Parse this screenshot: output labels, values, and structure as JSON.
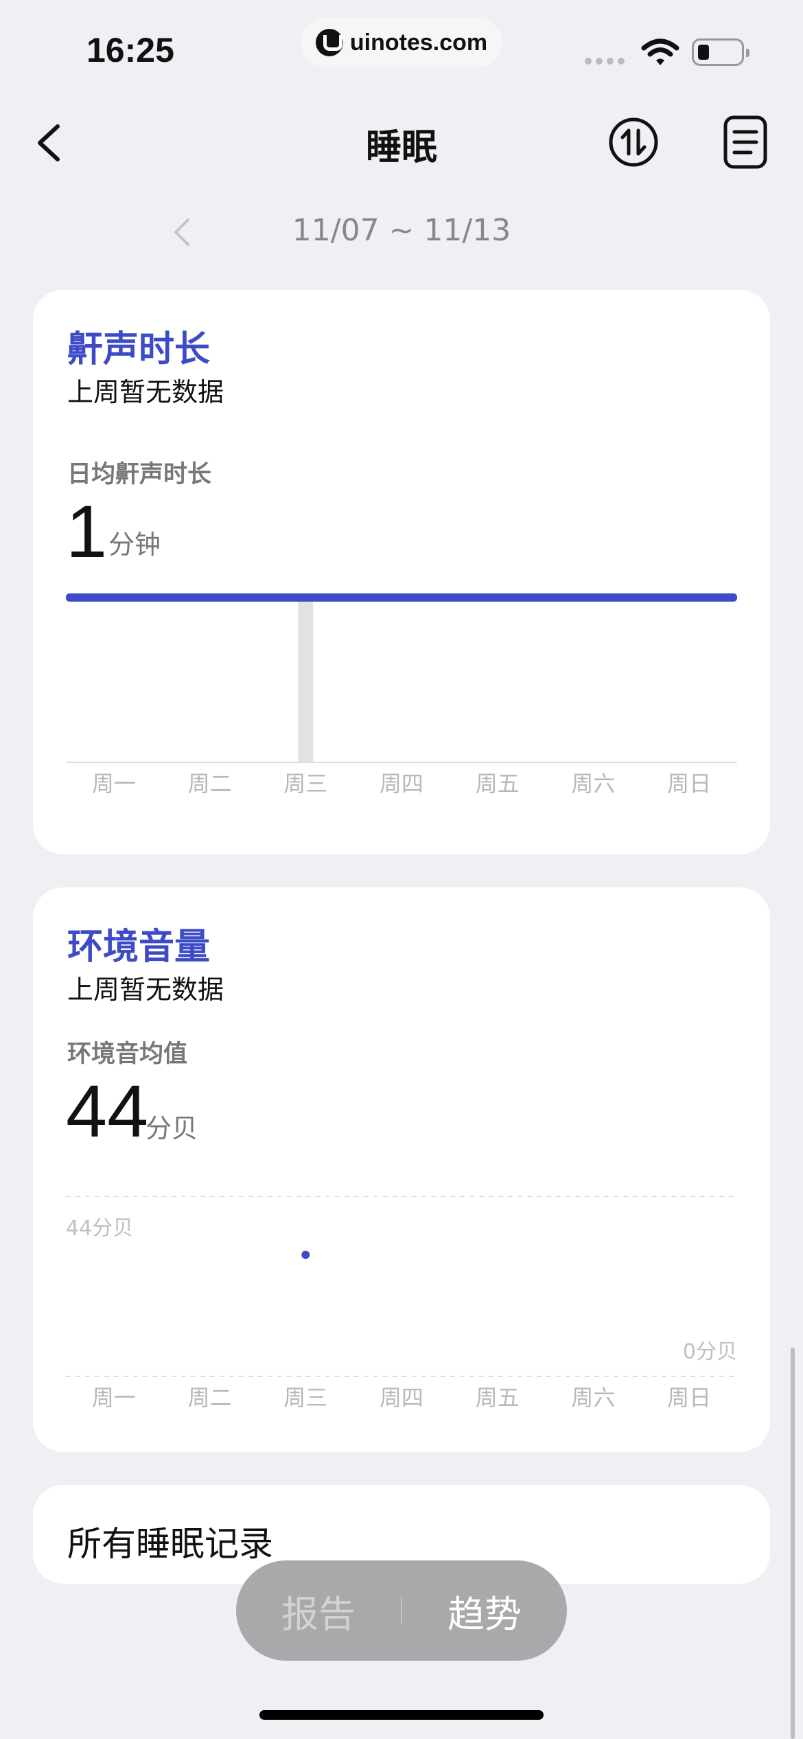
{
  "status_bar": {
    "time": "16:25",
    "url": "uinotes.com",
    "icons": [
      "signal-dots-icon",
      "wifi-icon",
      "battery-icon"
    ]
  },
  "nav": {
    "title": "睡眠",
    "icons": [
      "back-chevron-icon",
      "switch-arrows-icon",
      "list-document-icon"
    ]
  },
  "date_range": {
    "label": "11/07 ~ 11/13",
    "prev_icon": "chevron-left-icon"
  },
  "snore_card": {
    "title": "鼾声时长",
    "subtitle": "上周暂无数据",
    "metric_label": "日均鼾声时长",
    "metric_value": "1",
    "metric_unit": "分钟"
  },
  "env_card": {
    "title": "环境音量",
    "subtitle": "上周暂无数据",
    "metric_label": "环境音均值",
    "metric_value": "44",
    "metric_unit": "分贝"
  },
  "chart_data": [
    {
      "type": "bar",
      "categories": [
        "周一",
        "周二",
        "周三",
        "周四",
        "周五",
        "周六",
        "周日"
      ],
      "values": [
        0,
        0,
        1,
        0,
        0,
        0,
        0
      ],
      "average_line": 1,
      "ylim": [
        0,
        1
      ],
      "colors": {
        "average_line": "#3d4bc6",
        "bar": "#e2e2e2"
      }
    },
    {
      "type": "scatter",
      "categories": [
        "周一",
        "周二",
        "周三",
        "周四",
        "周五",
        "周六",
        "周日"
      ],
      "values": [
        null,
        null,
        44,
        null,
        null,
        null,
        null
      ],
      "y_tick_labels": {
        "top": "44分贝",
        "bottom": "0分贝"
      },
      "grid": "dashed",
      "colors": {
        "point": "#3d4bc6"
      }
    }
  ],
  "records_card": {
    "label": "所有睡眠记录"
  },
  "bottom_toggle": {
    "report_label": "报告",
    "trend_label": "趋势"
  },
  "colors": {
    "accent": "#3d4bc6",
    "background": "#efeff4",
    "card": "#ffffff"
  }
}
